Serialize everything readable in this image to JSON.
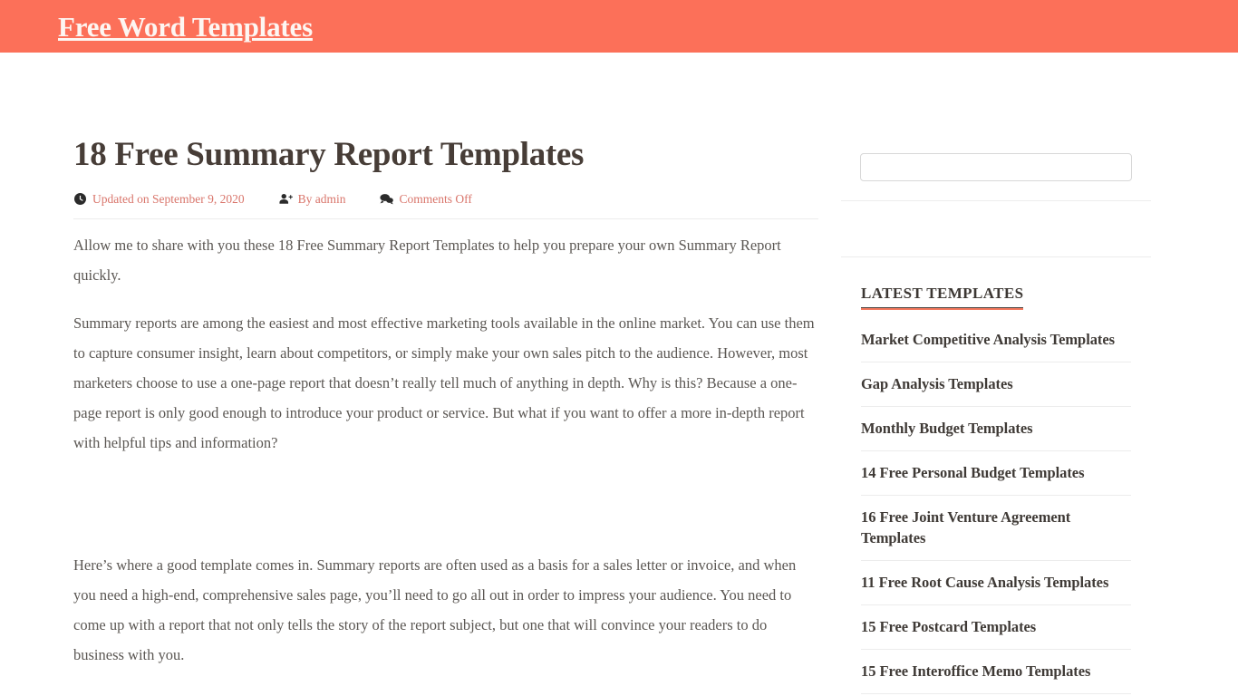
{
  "header": {
    "site_title": "Free Word Templates",
    "brand_color": "#fc7059"
  },
  "article": {
    "title": "18 Free Summary Report Templates",
    "meta": {
      "updated_icon": "clock-icon",
      "updated": "Updated on September 9, 2020",
      "author_icon": "user-plus-icon",
      "author": "By admin",
      "comments_icon": "comments-icon",
      "comments": "Comments Off",
      "meta_color": "#d9756b"
    },
    "paragraphs": [
      "Allow me to share with you these 18 Free Summary Report Templates to help you prepare your own Summary Report quickly.",
      "Summary reports are among the easiest and most effective marketing tools available in the online market. You can use them to capture consumer insight, learn about competitors, or simply make your own sales pitch to the audience. However, most marketers choose to use a one-page report that doesn’t really tell much of anything in depth. Why is this? Because a one-page report is only good enough to introduce your product or service. But what if you want to offer a more in-depth report with helpful tips and information?",
      "Here’s where a good template comes in. Summary reports are often used as a basis for a sales letter or invoice, and when you need a high-end, comprehensive sales page, you’ll need to go all out in order to impress your audience. You need to come up with a report that not only tells the story of the report subject, but one that will convince your readers to do business with you."
    ]
  },
  "sidebar": {
    "search": {
      "value": "",
      "placeholder": ""
    },
    "latest_widget": {
      "title": "LATEST TEMPLATES",
      "accent_color": "#f4795e",
      "items": [
        {
          "label": "Market Competitive Analysis Templates"
        },
        {
          "label": "Gap Analysis Templates"
        },
        {
          "label": "Monthly Budget Templates"
        },
        {
          "label": "14 Free Personal Budget Templates"
        },
        {
          "label": "16 Free Joint Venture Agreement Templates"
        },
        {
          "label": "11 Free Root Cause Analysis Templates"
        },
        {
          "label": "15 Free Postcard Templates"
        },
        {
          "label": "15 Free Interoffice Memo Templates"
        }
      ]
    }
  }
}
